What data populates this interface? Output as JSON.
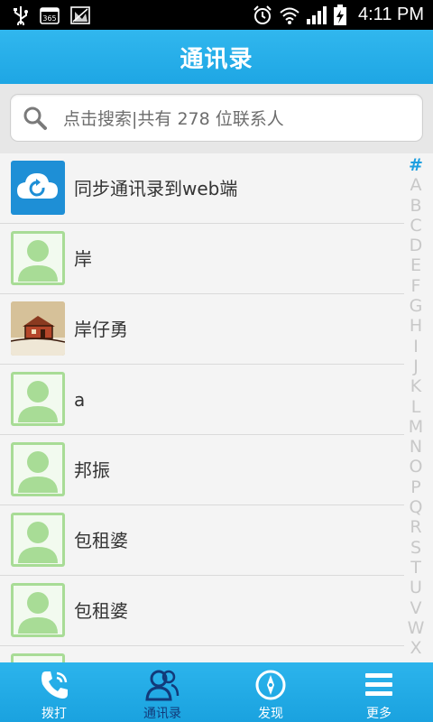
{
  "status_bar": {
    "time": "4:11 PM",
    "icons": [
      "usb-icon",
      "calendar-365-icon",
      "no-signal-image-icon",
      "alarm-icon",
      "wifi-icon",
      "signal-icon",
      "battery-charging-icon"
    ],
    "calendar_label": "365"
  },
  "header": {
    "title": "通讯录"
  },
  "search": {
    "placeholder": "点击搜索|共有 278 位联系人"
  },
  "contacts": [
    {
      "label": "同步通讯录到web端",
      "avatar": "cloud-sync-icon"
    },
    {
      "label": "岸",
      "avatar": "default-avatar-icon"
    },
    {
      "label": "岸仔勇",
      "avatar": "house-photo-avatar"
    },
    {
      "label": "a",
      "avatar": "default-avatar-icon"
    },
    {
      "label": "邦振",
      "avatar": "default-avatar-icon"
    },
    {
      "label": "包租婆",
      "avatar": "default-avatar-icon"
    },
    {
      "label": "包租婆",
      "avatar": "default-avatar-icon"
    },
    {
      "label": "",
      "avatar": "default-avatar-icon"
    }
  ],
  "alphabet_index": [
    "#",
    "A",
    "B",
    "C",
    "D",
    "E",
    "F",
    "G",
    "H",
    "I",
    "J",
    "K",
    "L",
    "M",
    "N",
    "O",
    "P",
    "Q",
    "R",
    "S",
    "T",
    "U",
    "V",
    "W",
    "X"
  ],
  "tabs": [
    {
      "label": "拨打",
      "icon": "phone-dial-icon",
      "active": false
    },
    {
      "label": "通讯录",
      "icon": "contacts-icon",
      "active": true
    },
    {
      "label": "发现",
      "icon": "compass-icon",
      "active": false
    },
    {
      "label": "更多",
      "icon": "menu-icon",
      "active": false
    }
  ],
  "colors": {
    "accent": "#1ea6e4",
    "avatar_green": "#a8dc96",
    "index_active": "#1e9fe0",
    "tab_active_label": "#123a7a"
  }
}
